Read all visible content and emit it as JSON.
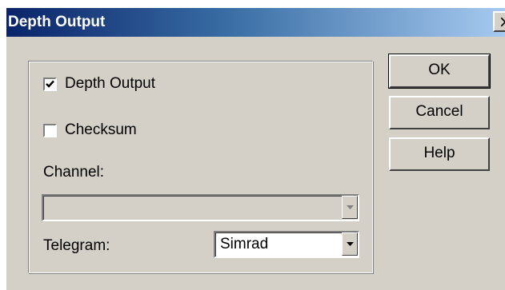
{
  "window": {
    "title": "Depth Output",
    "close_symbol": "✕"
  },
  "options": {
    "depth_output": {
      "label": "Depth Output",
      "checked": true
    },
    "checksum": {
      "label": "Checksum",
      "checked": false
    }
  },
  "channel": {
    "label": "Channel:",
    "value": "",
    "enabled": false
  },
  "telegram": {
    "label": "Telegram:",
    "value": "Simrad"
  },
  "buttons": {
    "ok": "OK",
    "cancel": "Cancel",
    "help": "Help"
  },
  "icons": {
    "checkbox_check": "check-icon",
    "dropdown": "chevron-down-icon",
    "close": "close-icon"
  },
  "colors": {
    "title_gradient_start": "#0a246a",
    "title_gradient_end": "#a6caf0",
    "dialog_face": "#d4d0c8"
  }
}
